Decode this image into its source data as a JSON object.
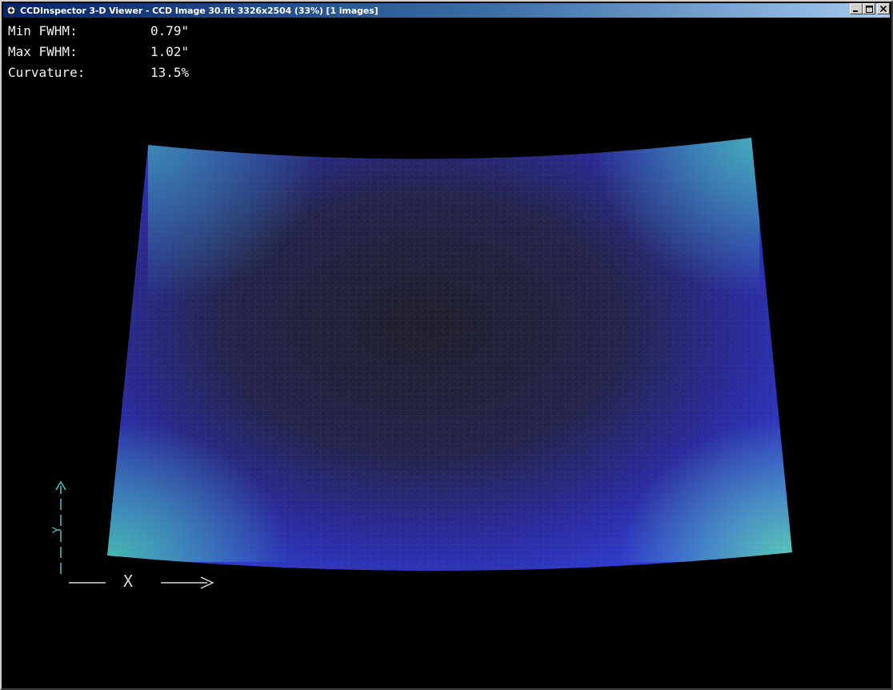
{
  "window": {
    "title": "CCDInspector 3-D Viewer - CCD Image 30.fit 3326x2504 (33%)  [1 images]",
    "icon": "ccdinspector-app-icon"
  },
  "controls": {
    "minimize_icon": "minimize-icon",
    "maximize_icon": "maximize-icon",
    "close_icon": "close-icon"
  },
  "stats": {
    "min_fwhm_label": "Min FWHM:",
    "min_fwhm_value": "0.79\"",
    "max_fwhm_label": "Max FWHM:",
    "max_fwhm_value": "1.02\"",
    "curvature_label": "Curvature:",
    "curvature_value": "13.5%"
  },
  "axes": {
    "x_label": "X",
    "y_label": "Y",
    "x_color": "#d8d8d8",
    "y_color": "#45c9c9"
  },
  "colors": {
    "background": "#000000",
    "surface_center": "#1e1e30",
    "surface_mid": "#2a2a9a",
    "surface_edge_blue": "#2b3ccf",
    "surface_corner": "#43b6b0"
  }
}
